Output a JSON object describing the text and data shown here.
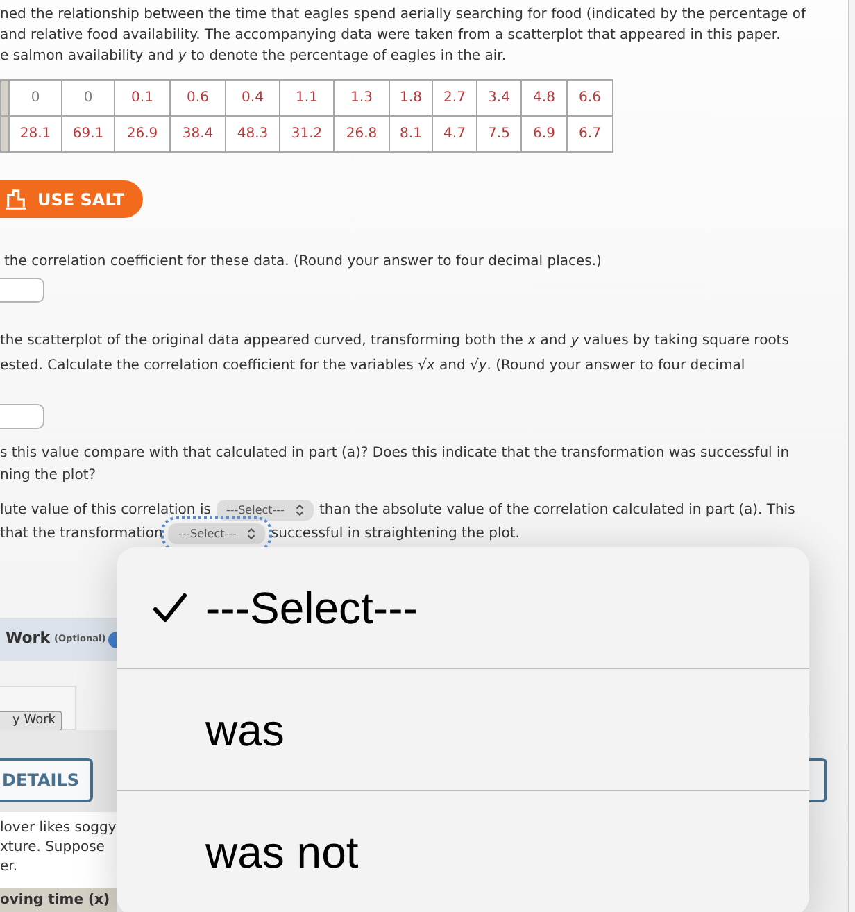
{
  "intro": {
    "lines": [
      "ned the relationship between the time that eagles spend aerially searching for food (indicated by the percentage of",
      "and relative food availability. The accompanying data were taken from a scatterplot that appeared in this paper.",
      "e salmon availability and *y* to denote the percentage of eagles in the air."
    ]
  },
  "table": {
    "rows": [
      {
        "cells": [
          {
            "text": "0",
            "color": "#808080"
          },
          {
            "text": "0",
            "color": "#808080"
          },
          {
            "text": "0.1",
            "color": "#b8383b"
          },
          {
            "text": "0.6",
            "color": "#b8383b"
          },
          {
            "text": "0.4",
            "color": "#b8383b"
          },
          {
            "text": "1.1",
            "color": "#b8383b"
          },
          {
            "text": "1.3",
            "color": "#b8383b"
          },
          {
            "text": "1.8",
            "color": "#b8383b"
          },
          {
            "text": "2.7",
            "color": "#b8383b"
          },
          {
            "text": "3.4",
            "color": "#b8383b"
          },
          {
            "text": "4.8",
            "color": "#b8383b"
          },
          {
            "text": "6.6",
            "color": "#b8383b"
          }
        ]
      },
      {
        "cells": [
          {
            "text": "28.1",
            "color": "#b8383b"
          },
          {
            "text": "69.1",
            "color": "#b8383b"
          },
          {
            "text": "26.9",
            "color": "#b8383b"
          },
          {
            "text": "38.4",
            "color": "#b8383b"
          },
          {
            "text": "48.3",
            "color": "#b8383b"
          },
          {
            "text": "31.2",
            "color": "#b8383b"
          },
          {
            "text": "26.8",
            "color": "#b8383b"
          },
          {
            "text": "8.1",
            "color": "#b8383b"
          },
          {
            "text": "4.7",
            "color": "#b8383b"
          },
          {
            "text": "7.5",
            "color": "#b8383b"
          },
          {
            "text": "6.9",
            "color": "#b8383b"
          },
          {
            "text": "6.7",
            "color": "#b8383b"
          }
        ]
      }
    ]
  },
  "salt_button": {
    "label": "USE SALT"
  },
  "part_a": {
    "lines": [
      "the correlation coefficient for these data. (Round your answer to four decimal places.)"
    ]
  },
  "part_b": {
    "lines": [
      "the scatterplot of the original data appeared curved, transforming both the *x* and *y* values by taking square roots",
      "ested. Calculate the correlation coefficient for the variables √*x* and √*y*. (Round your answer to four decimal"
    ]
  },
  "part_c": {
    "lines": [
      "s this value compare with that calculated in part (a)? Does this indicate that the transformation was successful in",
      "ning the plot?"
    ],
    "answer_lines": [
      [
        {
          "kind": "text",
          "text": "lute value of this correlation is"
        },
        {
          "kind": "select",
          "value": "---Select---",
          "focused": false
        },
        {
          "kind": "text",
          "text": "than the absolute value of the correlation calculated in part (a). This"
        }
      ],
      [
        {
          "kind": "text",
          "text": "that the transformation"
        },
        {
          "kind": "select",
          "value": "---Select---",
          "focused": true
        },
        {
          "kind": "text",
          "text": "successful in straightening the plot."
        }
      ]
    ]
  },
  "work_section": {
    "title": "Work",
    "note": "(Optional)",
    "button": "y Work"
  },
  "details_button": {
    "label": "DETAILS"
  },
  "next_problem": {
    "lines": [
      "lover likes soggy",
      "xture. Suppose",
      "er."
    ],
    "table_header": "oving time (x)"
  },
  "dropdown": {
    "options": [
      {
        "label": "---Select---",
        "selected": true
      },
      {
        "label": "was",
        "selected": false
      },
      {
        "label": "was not",
        "selected": false
      }
    ]
  }
}
